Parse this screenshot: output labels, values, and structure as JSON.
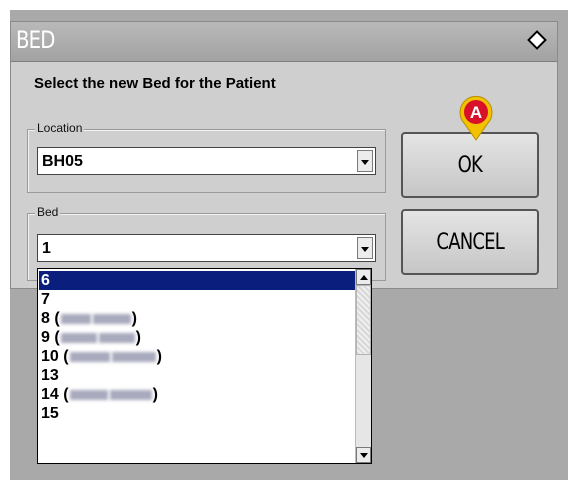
{
  "dialog": {
    "title": "BED",
    "prompt": "Select the new Bed for the Patient"
  },
  "location": {
    "group_label": "Location",
    "value": "BH05"
  },
  "bed": {
    "group_label": "Bed",
    "value": "1",
    "options": [
      {
        "label": "6",
        "suffix": "",
        "selected": true,
        "obscured": false
      },
      {
        "label": "7",
        "suffix": "",
        "selected": false,
        "obscured": false
      },
      {
        "label": "8 (",
        "suffix": ")",
        "selected": false,
        "obscured": true
      },
      {
        "label": "9 (",
        "suffix": ")",
        "selected": false,
        "obscured": true
      },
      {
        "label": "10 (",
        "suffix": ")",
        "selected": false,
        "obscured": true
      },
      {
        "label": "13",
        "suffix": "",
        "selected": false,
        "obscured": false
      },
      {
        "label": "14 (",
        "suffix": ")",
        "selected": false,
        "obscured": true
      },
      {
        "label": "15",
        "suffix": "",
        "selected": false,
        "obscured": false
      }
    ]
  },
  "buttons": {
    "ok": "OK",
    "cancel": "CANCEL"
  },
  "marker": {
    "letter": "A",
    "color": "#d8102a",
    "ring_color": "#f2c200"
  },
  "colors": {
    "selection": "#0a1f7d",
    "dialog_bg": "#cfcfcf",
    "backdrop": "#a9a9a9"
  }
}
